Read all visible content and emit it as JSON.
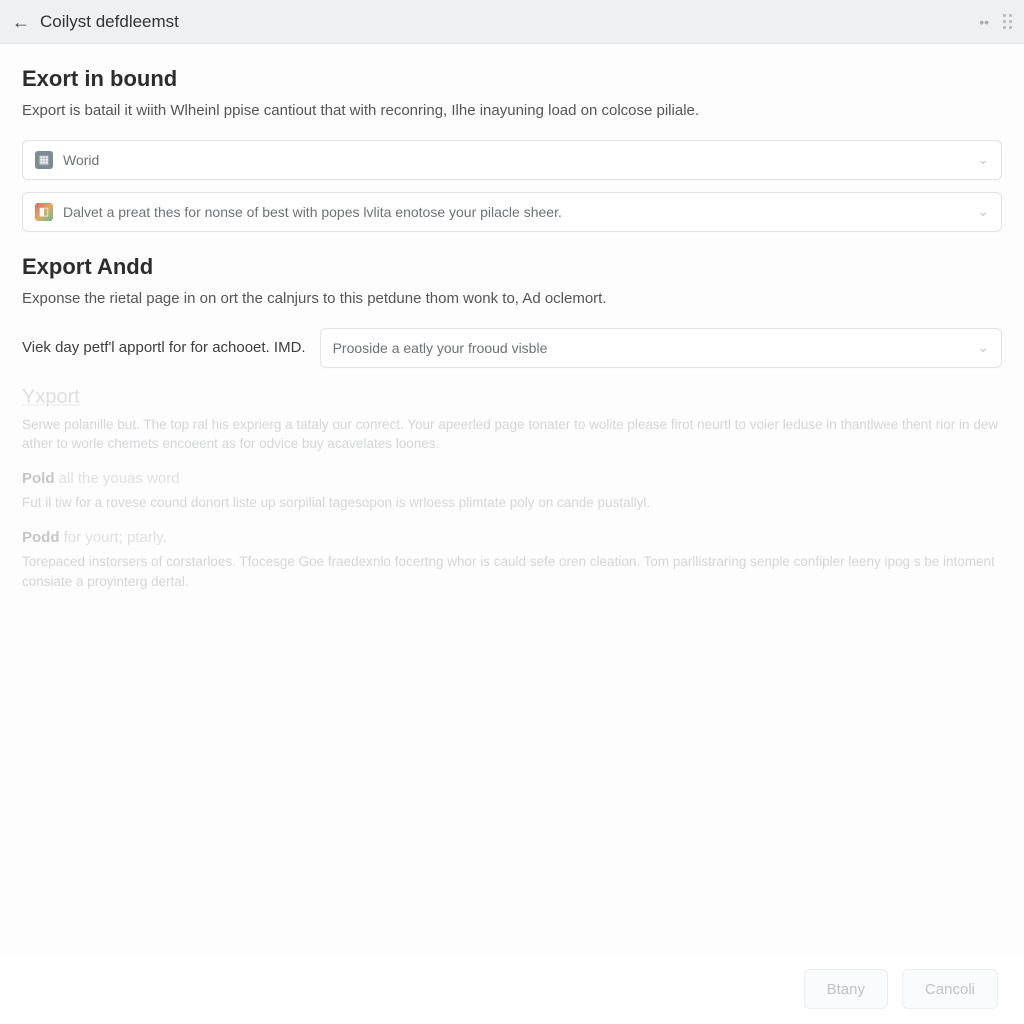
{
  "topbar": {
    "title": "Coilyst defdleemst"
  },
  "section1": {
    "title": "Exort in bound",
    "desc": "Export is batail it wiith Wlheinl ppise cantiout that with reconring, Ilhe inayuning load on colcose piliale.",
    "dropdown1": {
      "label": "Worid"
    },
    "dropdown2": {
      "label": "Dalvet a preat thes for nonse of best with popes lvlita enotose your pilacle sheer."
    }
  },
  "section2": {
    "title": "Export Andd",
    "desc": "Exponse the rietal page in on ort the calnjurs to this petdune thom wonk to, Ad oclemort.",
    "row_label": "Viek day petf'l apportl for for achooet. IMD.",
    "dropdown3": {
      "label": "Prooside a eatly your frooud visble"
    }
  },
  "faded": {
    "header": "Yxport",
    "p1": "Serwe polanille but. The top ral his exprierg a tataly our conrect. Your apeerled page tonater to wolite please firot neurtl to voier leduse in thantlwee thent rior in dew ather to worle chemets encoeent as for odvice buy acavelates loones.",
    "sub1_bold": "Pold",
    "sub1_rest": " all the youas word",
    "p2": "Fut il tiw for a rovese cound donort liste up sorpilial tagesopon is wrloess plimtate poly on cande pustallyl.",
    "sub2_bold": "Podd",
    "sub2_rest": " for yourt; ptarly.",
    "p3": "Torepaced instorsers of corstarloes. Tfocesge Goe fraedexnlo focertng whor is cauld sefe oren cleation. Tom parllistraring senple confipler leeny ipog s be intoment consiate a proyinterg dertal."
  },
  "footer": {
    "primary": "Btany",
    "cancel": "Cancoli"
  }
}
